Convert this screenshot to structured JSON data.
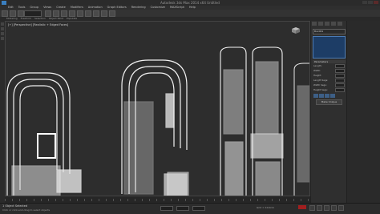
{
  "window": {
    "title": "Autodesk 3ds Max 2014 x64  Untitled"
  },
  "menubar": {
    "items": [
      "Edit",
      "Tools",
      "Group",
      "Views",
      "Create",
      "Modifiers",
      "Animation",
      "Graph Editors",
      "Rendering",
      "Customize",
      "MAXScript",
      "Help"
    ]
  },
  "ribbon": {
    "tabs": [
      "Modeling",
      "Freeform",
      "Selection",
      "Object Paint",
      "Populate"
    ]
  },
  "viewport": {
    "label": "[+] [Perspective] [Realistic + Edged Faces]"
  },
  "command_panel": {
    "name_value": "Box001",
    "section_parameters": "Parameters",
    "param_labels": [
      "Length:",
      "Width:",
      "Height:",
      "Length Segs:",
      "Width Segs:",
      "Height Segs:"
    ],
    "button_text": "Make Unique"
  },
  "status": {
    "selection": "1 Object Selected",
    "prompt": "Click or click-and-drag to select objects",
    "grid": "Grid = 10.0cm",
    "frame": "0 / 100"
  },
  "colors": {
    "viewport_bg": "#2d2d2d",
    "wire": "#f2f2f2",
    "selection_blue": "#1d3d66",
    "autokey_red": "#a21f1f"
  }
}
